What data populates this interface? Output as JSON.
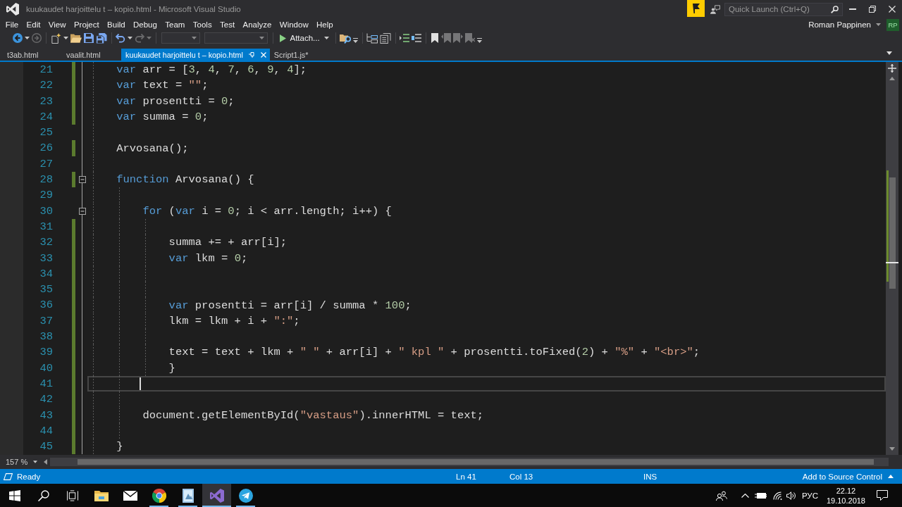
{
  "window": {
    "title": "kuukaudet harjoittelu t – kopio.html - Microsoft Visual Studio",
    "quick_launch": {
      "placeholder": "Quick Launch (Ctrl+Q)"
    }
  },
  "menu": [
    "File",
    "Edit",
    "View",
    "Project",
    "Build",
    "Debug",
    "Team",
    "Tools",
    "Test",
    "Analyze",
    "Window",
    "Help"
  ],
  "account": {
    "name": "Roman Pappinen",
    "initials": "RP"
  },
  "toolbar": {
    "groups": [
      [
        {
          "kind": "back",
          "disabled": false
        },
        {
          "kind": "caret",
          "disabled": false
        },
        {
          "kind": "forward",
          "disabled": true
        }
      ],
      [
        {
          "kind": "new-item",
          "disabled": false
        },
        {
          "kind": "caret",
          "disabled": false
        },
        {
          "kind": "open",
          "disabled": false
        },
        {
          "kind": "save",
          "disabled": false
        },
        {
          "kind": "save-all",
          "disabled": false
        }
      ],
      [
        {
          "kind": "undo",
          "disabled": false
        },
        {
          "kind": "caret",
          "disabled": false
        },
        {
          "kind": "redo",
          "disabled": true
        },
        {
          "kind": "caret",
          "disabled": true
        }
      ],
      [
        {
          "kind": "combo",
          "disabled": true
        },
        {
          "kind": "combo-wide",
          "disabled": true
        }
      ],
      [
        {
          "kind": "attach",
          "label": "Attach...",
          "disabled": false
        }
      ],
      [
        {
          "kind": "folder-search",
          "disabled": false
        },
        {
          "kind": "overflow",
          "disabled": false
        }
      ],
      [
        {
          "kind": "tree",
          "disabled": false
        },
        {
          "kind": "pages",
          "disabled": false
        }
      ],
      [
        {
          "kind": "lines-arrow",
          "disabled": false
        },
        {
          "kind": "lines-square",
          "disabled": false
        }
      ],
      [
        {
          "kind": "bookmark",
          "disabled": false
        },
        {
          "kind": "bookmark-prev",
          "disabled": true
        },
        {
          "kind": "bookmark-next",
          "disabled": true
        },
        {
          "kind": "bookmark-clear",
          "disabled": true
        },
        {
          "kind": "overflow",
          "disabled": false
        }
      ]
    ]
  },
  "tabs": [
    {
      "label": "t3ab.html",
      "selected": false
    },
    {
      "label": "vaalit.html",
      "selected": false
    },
    {
      "label": "kuukaudet harjoittelu t – kopio.html",
      "selected": true
    },
    {
      "label": "Script1.js*",
      "selected": false
    }
  ],
  "editor": {
    "lines": [
      {
        "number": "21",
        "changed": true,
        "current": false,
        "tokens": [
          {
            "kind": "keyword",
            "text": "var"
          },
          {
            "kind": "plain",
            "text": " arr = ["
          },
          {
            "kind": "number",
            "text": "3"
          },
          {
            "kind": "plain",
            "text": ", "
          },
          {
            "kind": "number",
            "text": "4"
          },
          {
            "kind": "plain",
            "text": ", "
          },
          {
            "kind": "number",
            "text": "7"
          },
          {
            "kind": "plain",
            "text": ", "
          },
          {
            "kind": "number",
            "text": "6"
          },
          {
            "kind": "plain",
            "text": ", "
          },
          {
            "kind": "number",
            "text": "9"
          },
          {
            "kind": "plain",
            "text": ", "
          },
          {
            "kind": "number",
            "text": "4"
          },
          {
            "kind": "plain",
            "text": "];"
          }
        ]
      },
      {
        "number": "22",
        "changed": true,
        "current": false,
        "tokens": [
          {
            "kind": "keyword",
            "text": "var"
          },
          {
            "kind": "plain",
            "text": " text = "
          },
          {
            "kind": "string",
            "text": "\"\""
          },
          {
            "kind": "plain",
            "text": ";"
          }
        ]
      },
      {
        "number": "23",
        "changed": true,
        "current": false,
        "tokens": [
          {
            "kind": "keyword",
            "text": "var"
          },
          {
            "kind": "plain",
            "text": " prosentti = "
          },
          {
            "kind": "number",
            "text": "0"
          },
          {
            "kind": "plain",
            "text": ";"
          }
        ]
      },
      {
        "number": "24",
        "changed": true,
        "current": false,
        "tokens": [
          {
            "kind": "keyword",
            "text": "var"
          },
          {
            "kind": "plain",
            "text": " summa = "
          },
          {
            "kind": "number",
            "text": "0"
          },
          {
            "kind": "plain",
            "text": ";"
          }
        ]
      },
      {
        "number": "25",
        "changed": false,
        "current": false
      },
      {
        "number": "26",
        "changed": true,
        "current": false,
        "tokens": [
          {
            "kind": "plain",
            "text": "Arvosana();"
          }
        ]
      },
      {
        "number": "27",
        "changed": false,
        "current": false
      },
      {
        "number": "28",
        "changed": true,
        "current": false,
        "expanded": true,
        "tokens": [
          {
            "kind": "keyword",
            "text": "function"
          },
          {
            "kind": "plain",
            "text": " Arvosana() {"
          }
        ],
        "children": [
          {
            "number": "29",
            "changed": false,
            "current": false
          },
          {
            "number": "30",
            "changed": false,
            "current": false,
            "expanded": true,
            "tokens": [
              {
                "kind": "keyword",
                "text": "for"
              },
              {
                "kind": "plain",
                "text": " ("
              },
              {
                "kind": "keyword",
                "text": "var"
              },
              {
                "kind": "plain",
                "text": " i = "
              },
              {
                "kind": "number",
                "text": "0"
              },
              {
                "kind": "plain",
                "text": "; i < arr.length; i++) {"
              }
            ],
            "children": [
              {
                "number": "31",
                "changed": true,
                "current": false
              },
              {
                "number": "32",
                "changed": true,
                "current": false,
                "tokens": [
                  {
                    "kind": "plain",
                    "text": "summa += + arr[i];"
                  }
                ]
              },
              {
                "number": "33",
                "changed": true,
                "current": false,
                "tokens": [
                  {
                    "kind": "keyword",
                    "text": "var"
                  },
                  {
                    "kind": "plain",
                    "text": " lkm = "
                  },
                  {
                    "kind": "number",
                    "text": "0"
                  },
                  {
                    "kind": "plain",
                    "text": ";"
                  }
                ]
              },
              {
                "number": "34",
                "changed": true,
                "current": false
              },
              {
                "number": "35",
                "changed": true,
                "current": false
              },
              {
                "number": "36",
                "changed": true,
                "current": false,
                "tokens": [
                  {
                    "kind": "keyword",
                    "text": "var"
                  },
                  {
                    "kind": "plain",
                    "text": " prosentti = arr[i] / summa * "
                  },
                  {
                    "kind": "number",
                    "text": "100"
                  },
                  {
                    "kind": "plain",
                    "text": ";"
                  }
                ]
              },
              {
                "number": "37",
                "changed": true,
                "current": false,
                "tokens": [
                  {
                    "kind": "plain",
                    "text": "lkm = lkm + i + "
                  },
                  {
                    "kind": "string",
                    "text": "\":\""
                  },
                  {
                    "kind": "plain",
                    "text": ";"
                  }
                ]
              },
              {
                "number": "38",
                "changed": true,
                "current": false
              },
              {
                "number": "39",
                "changed": true,
                "current": false,
                "tokens": [
                  {
                    "kind": "plain",
                    "text": "text = text + lkm + "
                  },
                  {
                    "kind": "string",
                    "text": "\" \""
                  },
                  {
                    "kind": "plain",
                    "text": " + arr[i] + "
                  },
                  {
                    "kind": "string",
                    "text": "\" kpl \""
                  },
                  {
                    "kind": "plain",
                    "text": " + prosentti.toFixed("
                  },
                  {
                    "kind": "number",
                    "text": "2"
                  },
                  {
                    "kind": "plain",
                    "text": ") + "
                  },
                  {
                    "kind": "string",
                    "text": "\"%\""
                  },
                  {
                    "kind": "plain",
                    "text": " + "
                  },
                  {
                    "kind": "string",
                    "text": "\"<br>\""
                  },
                  {
                    "kind": "plain",
                    "text": ";"
                  }
                ]
              },
              {
                "number": "40",
                "changed": true,
                "current": false,
                "tokens": [
                  {
                    "kind": "plain",
                    "text": "}"
                  }
                ]
              }
            ]
          },
          {
            "number": "41",
            "changed": true,
            "current": true
          },
          {
            "number": "42",
            "changed": true,
            "current": false
          },
          {
            "number": "43",
            "changed": true,
            "current": false,
            "tokens": [
              {
                "kind": "plain",
                "text": "document.getElementById("
              },
              {
                "kind": "string",
                "text": "\"vastaus\""
              },
              {
                "kind": "plain",
                "text": ").innerHTML = text;"
              }
            ]
          },
          {
            "number": "44",
            "changed": true,
            "current": false
          }
        ]
      },
      {
        "number": "45",
        "changed": true,
        "current": false,
        "tokens": [
          {
            "kind": "plain",
            "text": "}"
          }
        ]
      }
    ]
  },
  "zoom": "157 %",
  "status_bar": {
    "message": "Ready",
    "line": "Ln 41",
    "column": "Col 13",
    "mode": "INS",
    "source_control": "Add to Source Control"
  },
  "taskbar": {
    "apps": [
      {
        "kind": "folder",
        "running": false,
        "selected": false
      },
      {
        "kind": "mail",
        "running": false,
        "selected": false
      },
      {
        "kind": "browser",
        "running": true,
        "selected": false
      },
      {
        "kind": "photos",
        "running": true,
        "selected": false
      },
      {
        "kind": "ide",
        "running": true,
        "selected": true
      },
      {
        "kind": "messenger",
        "running": true,
        "selected": false
      }
    ],
    "language": "РУС",
    "time": "22.12",
    "date": "19.10.2018"
  }
}
